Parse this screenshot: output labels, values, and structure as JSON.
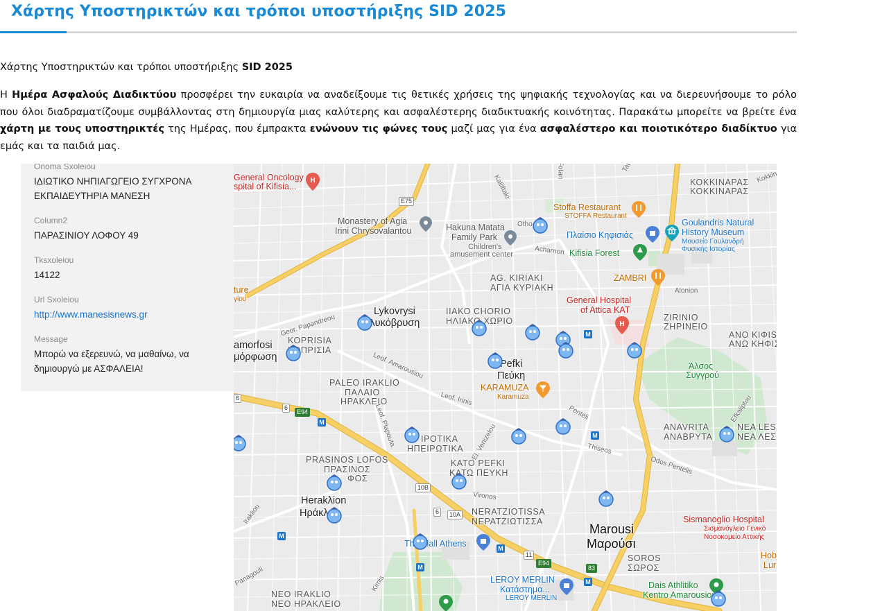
{
  "page": {
    "title": "Χάρτης Υποστηρικτών και τρόποι υποστήριξης SID 2025",
    "subtitle_text": "Χάρτης Υποστηρικτών και τρόποι υποστήριξης ",
    "subtitle_bold": "SID 2025",
    "intro": {
      "p1": "Η ",
      "b1": "Ημέρα Ασφαλούς Διαδικτύου",
      "p2": " προσφέρει την ευκαιρία να αναδείξουμε τις θετικές χρήσεις της ψηφιακής τεχνολογίας και να διερευνήσουμε το ρόλο που όλοι διαδραματίζουμε συμβάλλοντας στη δημιουργία μιας καλύτερης και ασφαλέστερης διαδικτυακής κοινότητας. Παρακάτω μπορείτε να βρείτε ένα ",
      "b2": "χάρτη με τους υποστηρικτές",
      "p3": " της Ημέρας, που έμπρακτα ",
      "b3": "ενώνουν τις φώνες τους",
      "p4": " μαζί μας για ένα ",
      "b4": "ασφαλέστερο και ποιοτικότερο διαδίκτυο",
      "p5": " για εμάς και τα παιδιά μας."
    }
  },
  "info_panel": {
    "fields": [
      {
        "label": "Onoma Sxoleiou",
        "value": "ΙΔΙΩΤΙΚΟ ΝΗΠΙΑΓΩΓΕΙΟ ΣΥΓΧΡΟΝΑ ΕΚΠΑΙΔΕΥΤΗΡΙΑ ΜΑΝΕΣΗ"
      },
      {
        "label": "Column2",
        "value": "ΠΑΡΑΣΙΝΙΟΥ ΛΟΦΟΥ 49"
      },
      {
        "label": "Tksxoleiou",
        "value": "14122"
      },
      {
        "label": "Url Sxoleiou",
        "value": "http://www.manesisnews.gr"
      },
      {
        "label": "Message",
        "value": "Μπορώ να εξερευνώ, να μαθαίνω, να δημιουργώ με ΑΣΦΑΛΕΙΑ!"
      }
    ]
  },
  "map": {
    "areas": {
      "kokkinaras": "ΚΟΚΚΙΝΑΡΑΣ",
      "kokkinaras_gr": "ΚΟΚΚΙΝΑΡΑΣ",
      "ag_kiriaki": "AG. KIRIAKI",
      "ag_kiriaki_gr": "ΑΓΙΑ ΚΥΡΙΑΚΗ",
      "zirinio": "ZIRINIO",
      "zirinio_gr": "ΖΗΡΙΝΕΙΟ",
      "iako": "ΙΙΑΚΟ CHORIO",
      "iako_gr": "ΗΛΙΑΚΟ ΧΩΡΙΟ",
      "koprisia": "ΚΟΡRISIA",
      "koprisia_gr": "ΚΟΠΡΙΣΙΑ",
      "paleo": "PALEO IRAKLIO",
      "paleo_gr1": "ΠΑΛΑΙΟ",
      "paleo_gr2": "ΗΡΑΚΛΕΙΟ",
      "ano_kifis": "ΑΝΟ ΚΙΦΙS",
      "ano_kifis_gr": "ΑΝΩ ΚΗΦΙΣ",
      "anavrita": "ANAVRITA",
      "anavrita_gr": "ΑΝΑΒΡΥΤΑ",
      "nea_les": "ΝΕΑ LES",
      "nea_les_gr": "ΝΕΑ ΛΕΣ",
      "irotika": "ΙΡΟΤΙΚΑ",
      "irotika_gr": "ΗΠΕΙΡΩΤΙΚΑ",
      "kato_pefki": "ΚΑΤΟ PEFKI",
      "kato_pefki_gr": "ΚΑΤΩ ΠΕΥΚΗ",
      "prasinos": "PRASINOS LOFOS",
      "prasinos_gr1": "ΠΡΑΣΙΝΟΣ",
      "prasinos_gr2": "ΦΟΣ",
      "neratziotissa": "NERATZIOTISSA",
      "neratziotissa_gr": "ΝΕΡΑΤΖΙΩΤΙΣΣΑ",
      "soros": "SOROS",
      "soros_gr": "ΣΩΡΟΣ",
      "neo_iraklio": "NEO IRAKLIO",
      "neo_iraklio_gr": "ΝΕΟ ΗΡΑΚΛΕΙΟ"
    },
    "cities": {
      "lykovrysi": "Lykovrysi",
      "lykovrysi_gr": "Λυκόβρυση",
      "metamorfosi": "amorfosi",
      "metamorfosi_gr": "μόρφωση",
      "pefki": "Pefki",
      "pefki_gr": "Πεύκη",
      "iraklio": "Herakλion",
      "iraklio_gr": "Ηράκλειο",
      "marousi": "Marousi",
      "marousi_gr": "Μαρούσι"
    },
    "pois": {
      "oncology1": "General Oncology",
      "oncology2": "spital of Kifisia...",
      "monastery1": "Monastery of Agia",
      "monastery2": "Irini Chrysovalantou",
      "hakuna1": "Hakuna Matata",
      "hakuna2": "Family Park",
      "hakuna_sub1": "Children's",
      "hakuna_sub2": "amusement center",
      "stoffa": "Stoffa Restaurant",
      "stoffa_gr": "STOFFA Restaurant",
      "plaisio": "Πλαίσιο Κηφισιάς",
      "goulandris1": "Goulandris Natural",
      "goulandris2": "History Museum",
      "goulandris_gr1": "Μουσείο Γουλανδρή",
      "goulandris_gr2": "Φυσικής Ιστορίας",
      "kifisia_forest": "Kifisia Forest",
      "zambri": "ZAMBRI",
      "kat1": "General Hospital",
      "kat2": "of Attica KAT",
      "alsos1": "Άλσος",
      "alsos2": "Συγγρού",
      "karamuza": "KARAMUZA",
      "karamuza_gr": "Karamuza",
      "future": "ture",
      "future_gr": "γίου",
      "sismanoglio1": "Sismanoglio Hospital",
      "sismanoglio2": "Σισμανόγλειο Γενικό",
      "sismanoglio3": "Νοσοκομείο Αττικής",
      "mall": "The Mall Athens",
      "leroy1": "LEROY MERLIN",
      "leroy2": "Κατάστημα...",
      "leroy3": "LEROY MERLIN",
      "dais1": "Dais Athlitiko",
      "dais2": "Kentro Amarousiou",
      "hobb1": "Hobb",
      "hobb2": "Lur"
    },
    "streets": {
      "kalliftaki": "Kalliftaki",
      "acharnon": "Acharnon",
      "othonos": "Otho",
      "papandreou": "Geor. Papandreou",
      "amaroysiou": "Leof. Amarousiou",
      "irinis": "Leof. Irinis",
      "plapouta": "Leof. Plapouta",
      "venizelou": "El. Venizelou",
      "penteli": "Odos Pentelis",
      "thiseos": "Thiseos",
      "viron": "Vironos",
      "alonion": "Alonion",
      "pentelis2": "Penteli",
      "irakliou": "Irakliou",
      "kimis": "Kimis",
      "panagouli": "Panagouli",
      "efkaliptou": "Efkaliptou",
      "kokkinaki": "Kokkin",
      "kolokotroni": "Tat",
      "tsolki": "Fotan"
    },
    "shields": {
      "e75": "E75",
      "e94": "E94",
      "e94b": "E94",
      "r6": "6",
      "r6b": "6",
      "r10a": "10A",
      "r10b": "10B",
      "r11": "11",
      "r83": "83",
      "r6c": "6"
    },
    "metro_label": "M",
    "colors": {
      "highway": "#f6cf65",
      "highway_edge": "#e2b33c",
      "road": "#ffffff",
      "park": "#c8e6c9",
      "water": "#aadaff"
    }
  }
}
